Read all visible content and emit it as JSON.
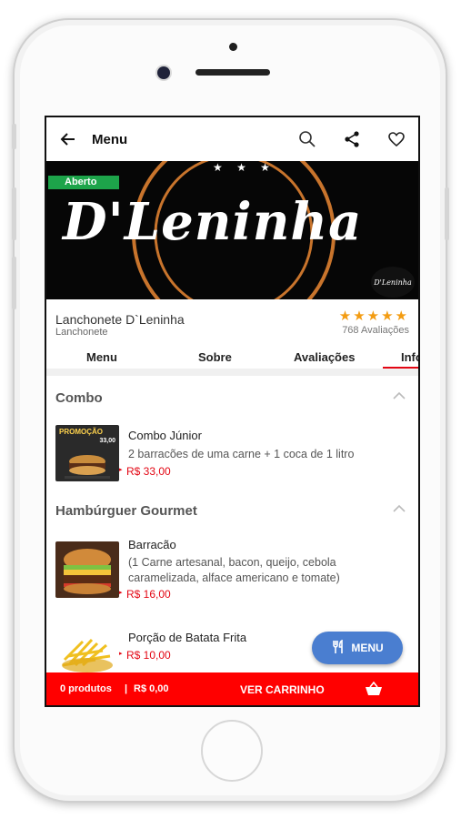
{
  "header": {
    "title": "Menu",
    "back_icon": "arrow-left-icon",
    "icons": [
      "search-icon",
      "share-icon",
      "heart-icon"
    ]
  },
  "banner": {
    "status": "Aberto",
    "brand_text": "D'Leninha",
    "stars": "★ ★ ★",
    "mini_logo_text": "D'Leninha"
  },
  "store": {
    "name": "Lanchonete D`Leninha",
    "category": "Lanchonete",
    "rating_value": 5,
    "rating_stars": "★★★★★",
    "reviews": "768 Avaliações"
  },
  "tabs": [
    {
      "label": "Menu"
    },
    {
      "label": "Sobre"
    },
    {
      "label": "Avaliações"
    },
    {
      "label": "Info",
      "active": true
    }
  ],
  "sections": [
    {
      "title": "Combo",
      "products": [
        {
          "name": "Combo Júnior",
          "description": "2 barracões de uma carne + 1 coca de 1 litro",
          "price": "R$ 33,00",
          "thumb_label": "PROMOÇÃO",
          "thumb_price": "33,00"
        }
      ]
    },
    {
      "title": "Hambúrguer Gourmet",
      "products": [
        {
          "name": "Barracão",
          "description": "(1 Carne artesanal, bacon, queijo, cebola caramelizada, alface americano e tomate)",
          "price": "R$ 16,00"
        },
        {
          "name": "Porção de Batata Frita",
          "description": "",
          "price": "R$ 10,00"
        }
      ]
    }
  ],
  "fab": {
    "label": "MENU",
    "icon": "fork-knife-icon"
  },
  "cart": {
    "count": "0 produtos",
    "separator": "|",
    "total": "R$ 0,00",
    "view_label": "VER CARRINHO",
    "icon": "basket-icon"
  },
  "colors": {
    "accent_red": "#ff0000",
    "price_red": "#e30613",
    "badge_green": "#1da44a",
    "fab_blue": "#4a7ed0",
    "star_orange": "#f39c12"
  }
}
